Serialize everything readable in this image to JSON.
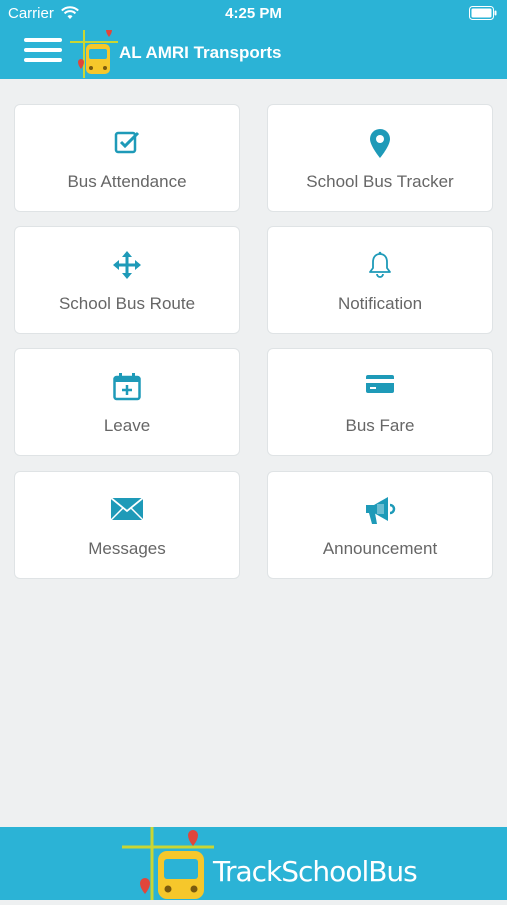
{
  "status_bar": {
    "carrier": "Carrier",
    "time": "4:25 PM"
  },
  "header": {
    "title": "AL AMRI Transports",
    "menu_icon": "hamburger-menu-icon",
    "logo": "school-bus-logo"
  },
  "tiles": [
    {
      "label": "Bus Attendance",
      "icon": "checkbox-icon"
    },
    {
      "label": "School Bus Tracker",
      "icon": "map-pin-icon"
    },
    {
      "label": "School Bus Route",
      "icon": "move-arrows-icon"
    },
    {
      "label": "Notification",
      "icon": "bell-icon"
    },
    {
      "label": "Leave",
      "icon": "calendar-plus-icon"
    },
    {
      "label": "Bus Fare",
      "icon": "credit-card-icon"
    },
    {
      "label": "Messages",
      "icon": "envelope-icon"
    },
    {
      "label": "Announcement",
      "icon": "megaphone-icon"
    }
  ],
  "footer": {
    "brand": "TrackSchoolBus"
  },
  "colors": {
    "accent": "#2bb3d6",
    "icon": "#1e9ab8",
    "background": "#eef0f1"
  }
}
